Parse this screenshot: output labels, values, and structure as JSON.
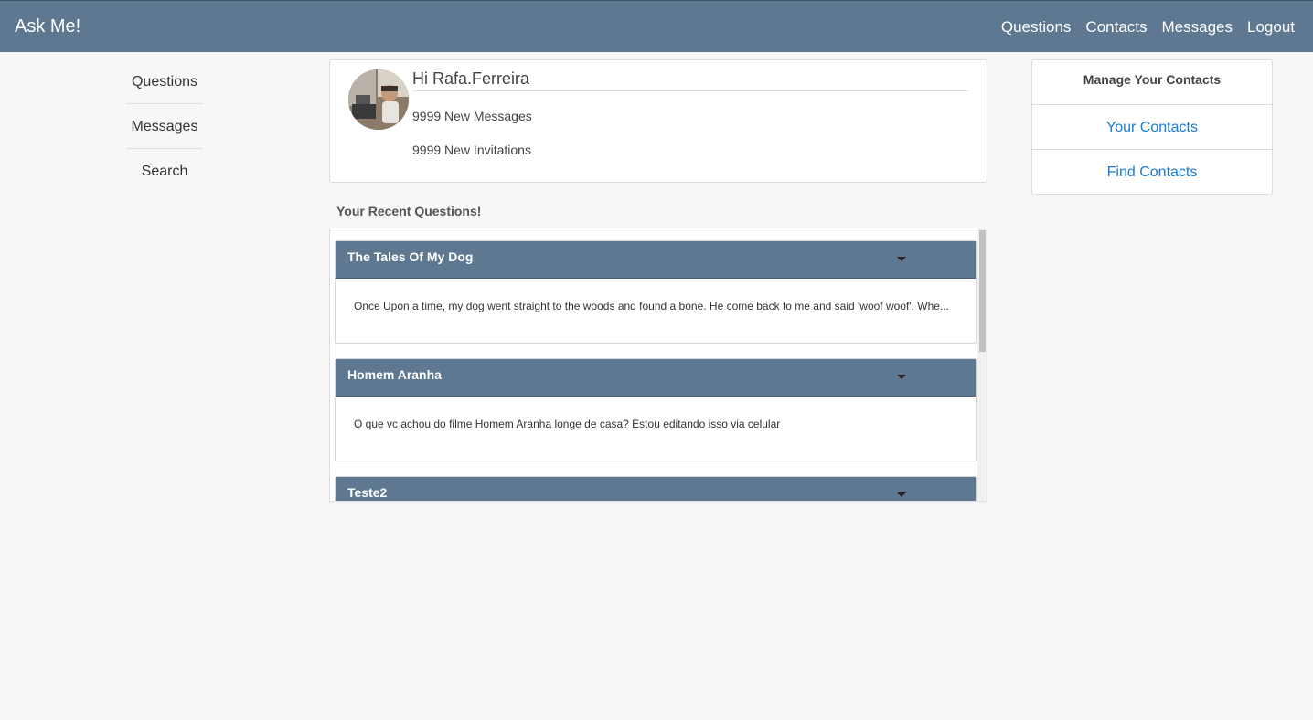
{
  "app": {
    "brand": "Ask Me!"
  },
  "topnav": {
    "items": [
      "Questions",
      "Contacts",
      "Messages",
      "Logout"
    ]
  },
  "sidenav": {
    "items": [
      "Questions",
      "Messages",
      "Search"
    ]
  },
  "profile": {
    "greeting": "Hi Rafa.Ferreira",
    "new_messages": "9999 New Messages",
    "new_invitations": "9999 New Invitations"
  },
  "questions_section": {
    "title": "Your Recent Questions!",
    "items": [
      {
        "title": "The Tales Of My Dog",
        "body": "Once Upon a time, my dog went straight to the woods and found a bone. He come back to me and said 'woof woof'. Whe..."
      },
      {
        "title": "Homem Aranha",
        "body": "O que vc achou do filme Homem Aranha longe de casa? Estou editando isso via celular"
      },
      {
        "title": "Teste2",
        "body": ""
      }
    ]
  },
  "contacts_panel": {
    "heading": "Manage Your Contacts",
    "links": [
      "Your Contacts",
      "Find Contacts"
    ]
  },
  "colors": {
    "navbar": "#5f7891",
    "link": "#1a7ad4"
  }
}
